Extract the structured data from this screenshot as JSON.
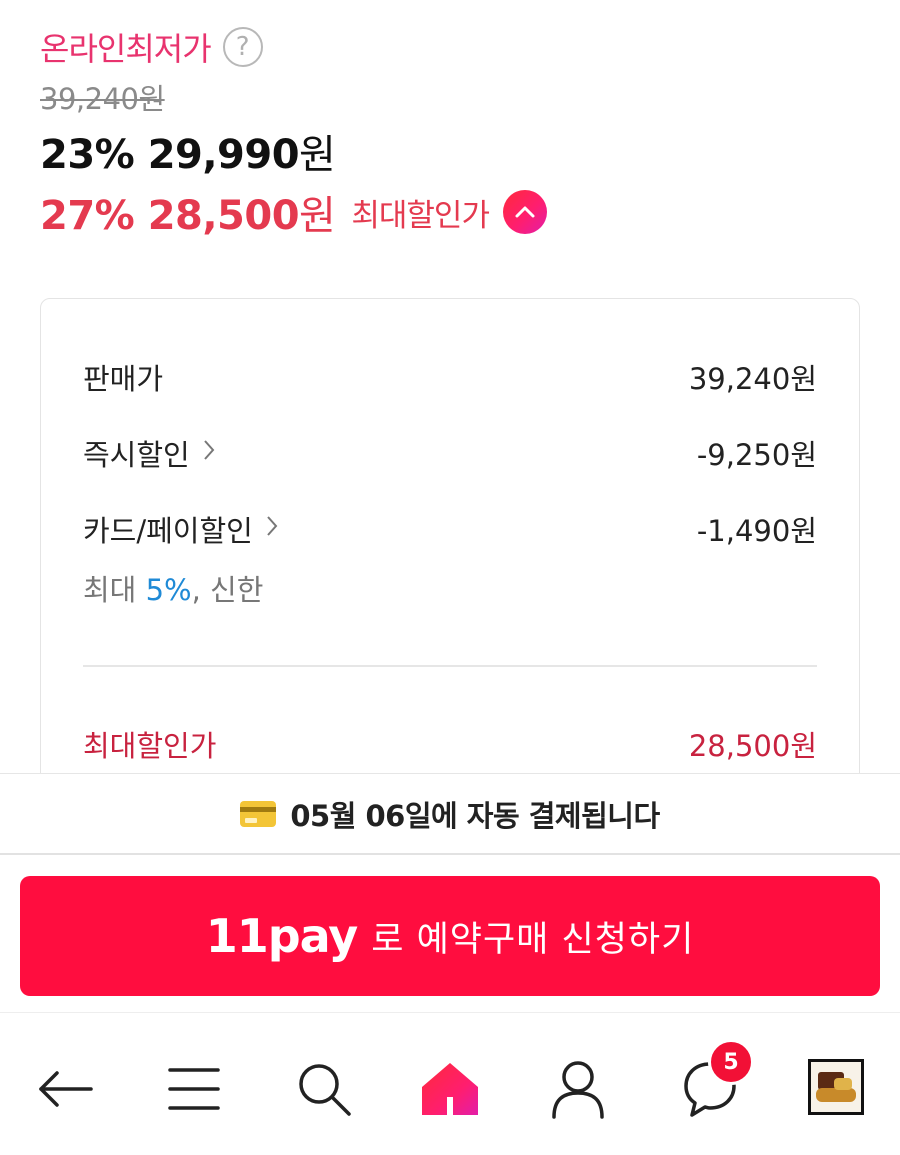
{
  "price_header": {
    "online_label": "온라인최저가",
    "help_icon": "?",
    "original_price": "39,240원",
    "sale_percent": "23%",
    "sale_amount": "29,990",
    "sale_unit": "원",
    "max_percent": "27%",
    "max_amount": "28,500",
    "max_unit": "원",
    "max_label": "최대할인가"
  },
  "breakdown": {
    "rows": [
      {
        "label": "판매가",
        "value": "39,240원"
      },
      {
        "label": "즉시할인",
        "value": "-9,250원"
      },
      {
        "label": "카드/페이할인",
        "value": "-1,490원"
      }
    ],
    "card_note_prefix": "최대 ",
    "card_note_percent": "5%",
    "card_note_suffix": ", 신한",
    "total_label": "최대할인가",
    "total_value": "28,500원"
  },
  "notice": {
    "text": "05월 06일에 자동 결제됩니다"
  },
  "pay_button": {
    "logo": "11pay",
    "label": "로 예약구매 신청하기"
  },
  "bottom_nav": {
    "icons": [
      "back-arrow-icon",
      "menu-icon",
      "search-icon",
      "home-icon",
      "user-icon",
      "chat-icon",
      "recent-product-thumbnail"
    ],
    "chat_badge": "5"
  },
  "colors": {
    "accent_pink": "#e8336e",
    "discount_red": "#e43a4f",
    "pay_button": "#ff0d3f",
    "percent_blue": "#1f8ad6"
  }
}
